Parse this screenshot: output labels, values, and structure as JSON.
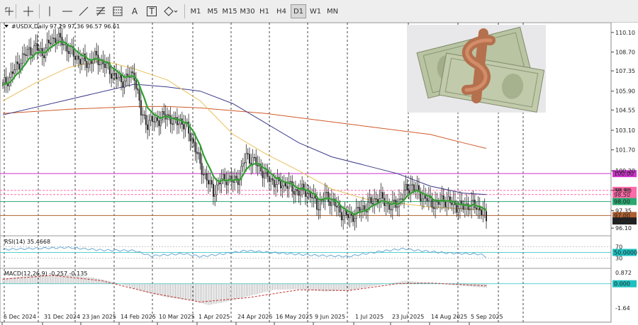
{
  "toolbar": {
    "tools": [
      {
        "name": "crosshair-icon"
      },
      {
        "name": "cursor-cross-icon"
      },
      {
        "name": "vertical-line-icon"
      },
      {
        "name": "horizontal-line-icon"
      },
      {
        "name": "trend-line-icon"
      },
      {
        "name": "fibonacci-icon"
      },
      {
        "name": "fibo-fan-icon"
      },
      {
        "name": "text-label-icon",
        "label": "A"
      },
      {
        "name": "text-box-icon",
        "label": "T"
      },
      {
        "name": "shapes-icon"
      }
    ],
    "timeframes": [
      "M1",
      "M5",
      "M15",
      "M30",
      "H1",
      "H4",
      "D1",
      "W1",
      "MN"
    ],
    "active_timeframe": "D1"
  },
  "header": {
    "symbol": "#USDX,Daily",
    "ohlc": "97.29 97.36 96.57 96.61"
  },
  "rsi_label": "RSI(14) 35.4668",
  "macd_label": "MACD(12,26,9) -0.257 -0.135",
  "colors": {
    "bull": "#2a2a2a",
    "ema_fast": "#1a8a1a",
    "ema_slow": "#66c266",
    "ma_mid": "#e8c05a",
    "ma_100": "#3a3a8a",
    "ma_200": "#d05a2a",
    "magenta_level": "#cc33cc",
    "pink_level": "#ff6aa8",
    "green_level": "#2aa870",
    "brown_level": "#b06030",
    "rsi_line": "#5aa0d0",
    "rsi_level": "#20c0c0",
    "macd_hist": "#b0b0b0",
    "macd_signal": "#c03030"
  },
  "chart_data": {
    "type": "candlestick",
    "symbol": "#USDX",
    "timeframe": "Daily",
    "last_ohlc": {
      "open": 97.29,
      "high": 97.36,
      "low": 96.57,
      "close": 96.61
    },
    "price_ticks": [
      110.1,
      108.7,
      107.35,
      105.9,
      104.55,
      103.1,
      101.7,
      100.2,
      98.8,
      97.35,
      96.1
    ],
    "price_range": [
      95.6,
      110.7
    ],
    "date_labels": [
      "5 Dec 2024",
      "31 Dec 2024",
      "23 Jan 2025",
      "14 Feb 2025",
      "10 Mar 2025",
      "1 Apr 2025",
      "24 Apr 2025",
      "16 May 2025",
      "9 Jun 2025",
      "1 Jul 2025",
      "23 Jul 2025",
      "14 Aug 2025",
      "5 Sep 2025"
    ],
    "close_path": [
      [
        0,
        106.3
      ],
      [
        4,
        106.9
      ],
      [
        8,
        107.6
      ],
      [
        12,
        108.3
      ],
      [
        16,
        108.8
      ],
      [
        20,
        109.0
      ],
      [
        24,
        108.6
      ],
      [
        28,
        109.3
      ],
      [
        32,
        109.8
      ],
      [
        36,
        109.4
      ],
      [
        40,
        108.9
      ],
      [
        44,
        108.4
      ],
      [
        48,
        108.1
      ],
      [
        52,
        107.9
      ],
      [
        56,
        108.3
      ],
      [
        60,
        108.0
      ],
      [
        64,
        107.5
      ],
      [
        68,
        107.0
      ],
      [
        72,
        106.6
      ],
      [
        76,
        106.9
      ],
      [
        80,
        107.1
      ],
      [
        84,
        104.3
      ],
      [
        88,
        103.6
      ],
      [
        92,
        103.8
      ],
      [
        96,
        103.9
      ],
      [
        100,
        104.2
      ],
      [
        104,
        103.6
      ],
      [
        108,
        103.8
      ],
      [
        112,
        103.2
      ],
      [
        116,
        102.2
      ],
      [
        120,
        100.6
      ],
      [
        124,
        99.6
      ],
      [
        128,
        98.7
      ],
      [
        132,
        99.4
      ],
      [
        136,
        99.7
      ],
      [
        140,
        99.4
      ],
      [
        144,
        99.8
      ],
      [
        148,
        101.3
      ],
      [
        152,
        100.9
      ],
      [
        156,
        100.5
      ],
      [
        160,
        99.8
      ],
      [
        164,
        99.5
      ],
      [
        168,
        99.2
      ],
      [
        172,
        99.3
      ],
      [
        176,
        98.9
      ],
      [
        180,
        98.7
      ],
      [
        184,
        98.8
      ],
      [
        188,
        98.3
      ],
      [
        192,
        97.7
      ],
      [
        196,
        98.4
      ],
      [
        200,
        98.1
      ],
      [
        204,
        97.4
      ],
      [
        208,
        97.0
      ],
      [
        212,
        96.9
      ],
      [
        216,
        97.3
      ],
      [
        220,
        97.6
      ],
      [
        224,
        97.9
      ],
      [
        228,
        98.3
      ],
      [
        232,
        98.0
      ],
      [
        236,
        97.6
      ],
      [
        240,
        97.9
      ],
      [
        244,
        98.6
      ],
      [
        248,
        99.2
      ],
      [
        252,
        98.7
      ],
      [
        256,
        98.3
      ],
      [
        260,
        98.0
      ],
      [
        264,
        97.8
      ],
      [
        268,
        98.2
      ],
      [
        272,
        97.9
      ],
      [
        276,
        97.7
      ],
      [
        280,
        97.6
      ],
      [
        284,
        97.8
      ],
      [
        288,
        97.6
      ],
      [
        292,
        97.4
      ],
      [
        294,
        96.61
      ]
    ],
    "ma_100": [
      [
        0,
        104.2
      ],
      [
        40,
        105.3
      ],
      [
        80,
        106.4
      ],
      [
        100,
        106.2
      ],
      [
        120,
        105.9
      ],
      [
        140,
        105.0
      ],
      [
        160,
        103.6
      ],
      [
        180,
        102.2
      ],
      [
        200,
        101.2
      ],
      [
        220,
        100.6
      ],
      [
        240,
        100.0
      ],
      [
        260,
        99.1
      ],
      [
        280,
        98.6
      ],
      [
        294,
        98.5
      ]
    ],
    "ma_200": [
      [
        0,
        104.3
      ],
      [
        40,
        104.6
      ],
      [
        80,
        104.8
      ],
      [
        100,
        104.8
      ],
      [
        120,
        104.7
      ],
      [
        140,
        104.5
      ],
      [
        160,
        104.3
      ],
      [
        180,
        104.0
      ],
      [
        200,
        103.7
      ],
      [
        220,
        103.4
      ],
      [
        240,
        103.1
      ],
      [
        260,
        102.8
      ],
      [
        280,
        102.2
      ],
      [
        294,
        101.8
      ]
    ],
    "ma_mid": [
      [
        0,
        105.2
      ],
      [
        20,
        106.5
      ],
      [
        40,
        107.6
      ],
      [
        60,
        108.1
      ],
      [
        80,
        107.5
      ],
      [
        100,
        106.7
      ],
      [
        120,
        105.2
      ],
      [
        140,
        102.8
      ],
      [
        160,
        101.4
      ],
      [
        180,
        100.2
      ],
      [
        200,
        98.9
      ],
      [
        220,
        98.2
      ],
      [
        240,
        97.9
      ],
      [
        260,
        97.6
      ],
      [
        294,
        97.4
      ]
    ],
    "levels": [
      {
        "value": 100.0,
        "label": "100.00",
        "color": "#cc33cc"
      },
      {
        "value": 98.8,
        "label": "98.80",
        "color": "#ff6aa8"
      },
      {
        "value": 98.5,
        "label": "98.50",
        "color": "#ff6aa8"
      },
      {
        "value": 98.0,
        "label": "98.00",
        "color": "#2aa870"
      },
      {
        "value": 97.0,
        "label": "97.00",
        "color": "#b06030"
      }
    ],
    "rsi": {
      "period": 14,
      "value": 35.4668,
      "levels": [
        70,
        50,
        30
      ],
      "level_labels": [
        "70",
        "50.0000",
        "30"
      ],
      "path": [
        [
          0,
          60
        ],
        [
          20,
          64
        ],
        [
          40,
          67
        ],
        [
          60,
          58
        ],
        [
          80,
          56
        ],
        [
          90,
          38
        ],
        [
          110,
          46
        ],
        [
          120,
          36
        ],
        [
          130,
          42
        ],
        [
          148,
          56
        ],
        [
          170,
          47
        ],
        [
          190,
          40
        ],
        [
          210,
          36
        ],
        [
          230,
          54
        ],
        [
          244,
          63
        ],
        [
          250,
          58
        ],
        [
          270,
          48
        ],
        [
          290,
          44
        ],
        [
          294,
          35.5
        ]
      ]
    },
    "macd": {
      "fast": 12,
      "slow": 26,
      "signal": 9,
      "macd": -0.257,
      "signal_value": -0.135,
      "ticks": [
        "0.872",
        "0.000",
        "-1.64"
      ],
      "range": [
        -1.64,
        0.872
      ],
      "hist": [
        [
          0,
          0.35
        ],
        [
          20,
          0.55
        ],
        [
          40,
          0.6
        ],
        [
          55,
          0.4
        ],
        [
          70,
          0.05
        ],
        [
          85,
          -0.5
        ],
        [
          100,
          -0.9
        ],
        [
          115,
          -1.1
        ],
        [
          125,
          -1.4
        ],
        [
          135,
          -1.2
        ],
        [
          150,
          -0.8
        ],
        [
          165,
          -0.4
        ],
        [
          180,
          -0.35
        ],
        [
          195,
          -0.5
        ],
        [
          210,
          -0.45
        ],
        [
          225,
          -0.15
        ],
        [
          245,
          0.2
        ],
        [
          260,
          0.05
        ],
        [
          280,
          -0.15
        ],
        [
          294,
          -0.26
        ]
      ],
      "signal_path": [
        [
          0,
          0.3
        ],
        [
          30,
          0.55
        ],
        [
          60,
          0.2
        ],
        [
          90,
          -0.6
        ],
        [
          120,
          -1.2
        ],
        [
          150,
          -0.9
        ],
        [
          180,
          -0.4
        ],
        [
          210,
          -0.45
        ],
        [
          240,
          0.0
        ],
        [
          260,
          0.05
        ],
        [
          294,
          -0.135
        ]
      ]
    }
  }
}
